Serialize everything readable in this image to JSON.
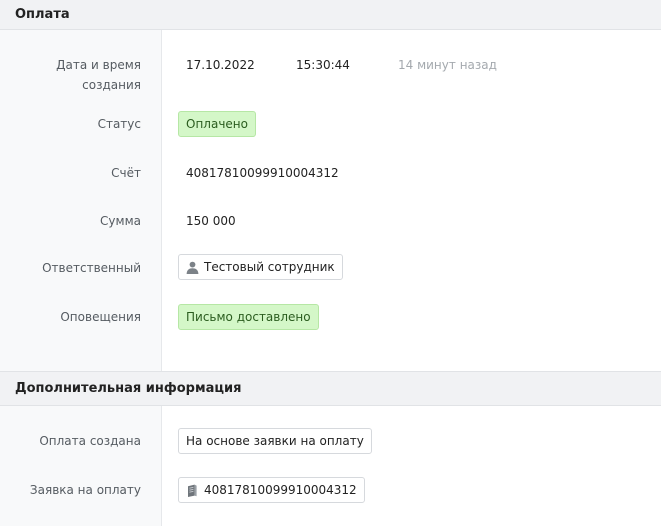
{
  "payment": {
    "header": "Оплата",
    "fields": {
      "created_label": "Дата и время создания",
      "created_date": "17.10.2022",
      "created_time": "15:30:44",
      "created_ago": "14 минут назад",
      "status_label": "Статус",
      "status_value": "Оплачено",
      "account_label": "Счёт",
      "account_value": "40817810099910004312",
      "amount_label": "Сумма",
      "amount_value": "150 000",
      "responsible_label": "Ответственный",
      "responsible_value": "Тестовый сотрудник",
      "notifications_label": "Оповещения",
      "notifications_value": "Письмо доставлено"
    }
  },
  "additional": {
    "header": "Дополнительная информация",
    "fields": {
      "created_by_label": "Оплата создана",
      "created_by_value": "На основе заявки на оплату",
      "request_label": "Заявка на оплату",
      "request_value": "40817810099910004312"
    }
  },
  "icons": {
    "responsible": "user-icon",
    "request": "document-icon"
  },
  "colors": {
    "status_badge_bg": "#d4f7c8",
    "status_badge_border": "#b6e7a5",
    "section_header_bg": "#f1f2f4",
    "label_column_bg": "#f8f9fa"
  }
}
